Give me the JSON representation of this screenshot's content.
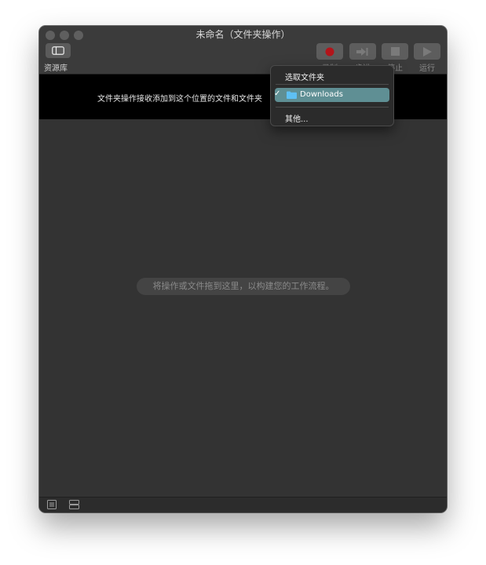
{
  "window": {
    "title": "未命名（文件夹操作）"
  },
  "toolbar": {
    "library_label": "资源库",
    "buttons": [
      {
        "label": "录制",
        "icon": "record-icon"
      },
      {
        "label": "步进",
        "icon": "step-icon"
      },
      {
        "label": "停止",
        "icon": "stop-icon"
      },
      {
        "label": "运行",
        "icon": "run-icon"
      }
    ]
  },
  "folder_action": {
    "prompt": "文件夹操作接收添加到这个位置的文件和文件夹"
  },
  "workflow": {
    "hint": "将操作或文件拖到这里，以构建您的工作流程。"
  },
  "dropdown": {
    "header": "选取文件夹",
    "selected": "Downloads",
    "selected_check": "✓",
    "other": "其他..."
  },
  "colors": {
    "record_red": "#b3141a",
    "selection": "#5f8f94",
    "folder_blue": "#5ec0f3"
  }
}
